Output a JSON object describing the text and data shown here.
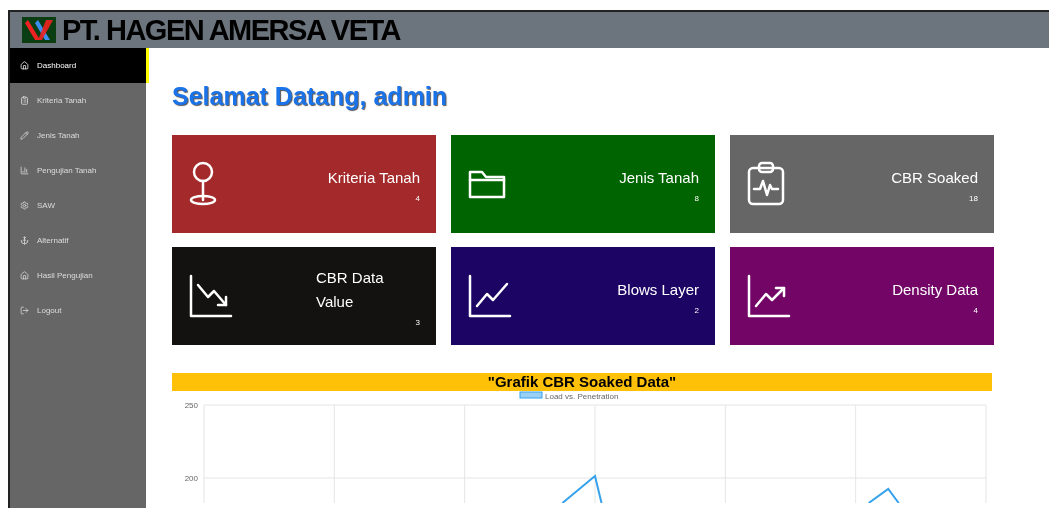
{
  "header": {
    "brand": "PT. HAGEN AMERSA VETA"
  },
  "sidebar": {
    "items": [
      {
        "label": "Dashboard",
        "selected": true
      },
      {
        "label": "Kriteria Tanah",
        "selected": false
      },
      {
        "label": "Jenis Tanah",
        "selected": false
      },
      {
        "label": "Pengujian Tanah",
        "selected": false
      },
      {
        "label": "SAW",
        "selected": false
      },
      {
        "label": "Alternatif",
        "selected": false
      },
      {
        "label": "Hasil Pengujian",
        "selected": false
      },
      {
        "label": "Logout",
        "selected": false
      }
    ]
  },
  "welcome": "Selamat Datang, admin",
  "cards": [
    {
      "title": "Kriteria Tanah",
      "count": "4",
      "color": "#a4292b"
    },
    {
      "title": "Jenis Tanah",
      "count": "8",
      "color": "#006400"
    },
    {
      "title": "CBR Soaked",
      "count": "18",
      "color": "#666666"
    },
    {
      "title": "CBR Data Value",
      "count": "3",
      "color": "#141111"
    },
    {
      "title": "Blows Layer",
      "count": "2",
      "color": "#1c0464"
    },
    {
      "title": "Density Data",
      "count": "4",
      "color": "#730567"
    }
  ],
  "chart": {
    "heading": "\"Grafik CBR Soaked Data\"",
    "legend": "Load vs. Penetration",
    "y_axis_labels": [
      "250",
      "200"
    ]
  }
}
